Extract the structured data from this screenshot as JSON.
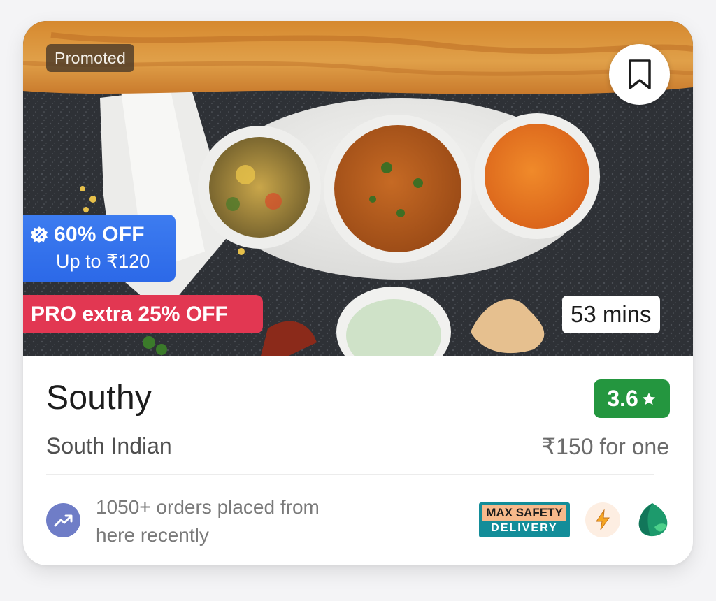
{
  "card": {
    "promoted_label": "Promoted",
    "offer": {
      "title": "60% OFF",
      "subtitle": "Up to ₹120"
    },
    "pro_offer": "PRO extra 25% OFF",
    "delivery_time": "53 mins",
    "bookmark_icon": "bookmark-icon"
  },
  "restaurant": {
    "name": "Southy",
    "rating": "3.6",
    "rating_color": "#24963f",
    "cuisine": "South Indian",
    "price": "₹150 for one"
  },
  "footer": {
    "orders_line1": "1050+ orders placed from",
    "orders_line2": "here recently",
    "badges": {
      "safety_top": "MAX SAFETY",
      "safety_bottom": "DELIVERY",
      "icons": [
        "trending-up-icon",
        "lightning-bolt-icon",
        "leaf-icon"
      ]
    }
  },
  "colors": {
    "offer_blue": "#2c69e8",
    "pro_red": "#e23752",
    "accent_green": "#24963f"
  }
}
